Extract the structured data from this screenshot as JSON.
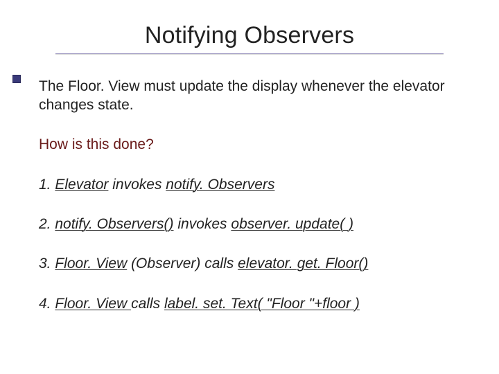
{
  "title": "Notifying Observers",
  "intro": "The Floor. View must update the display whenever the elevator changes state.",
  "question": "How is this done?",
  "steps": {
    "s1": {
      "num": "1. ",
      "u1": "Elevator",
      "mid": " invokes ",
      "u2": "notify. Observers",
      "tail": ""
    },
    "s2": {
      "num": "2. ",
      "u1": "notify. Observers()",
      "mid": " invokes ",
      "u2": "observer. update( )",
      "tail": ""
    },
    "s3": {
      "num": "3. ",
      "u1": "Floor. View",
      "mid": " (Observer) calls ",
      "u2": "elevator. get. Floor()",
      "tail": ""
    },
    "s4": {
      "num": "4. ",
      "u1": "Floor. View ",
      "mid": " calls ",
      "u2": "label. set. Text( \"Floor \"+floor )",
      "tail": ""
    }
  }
}
